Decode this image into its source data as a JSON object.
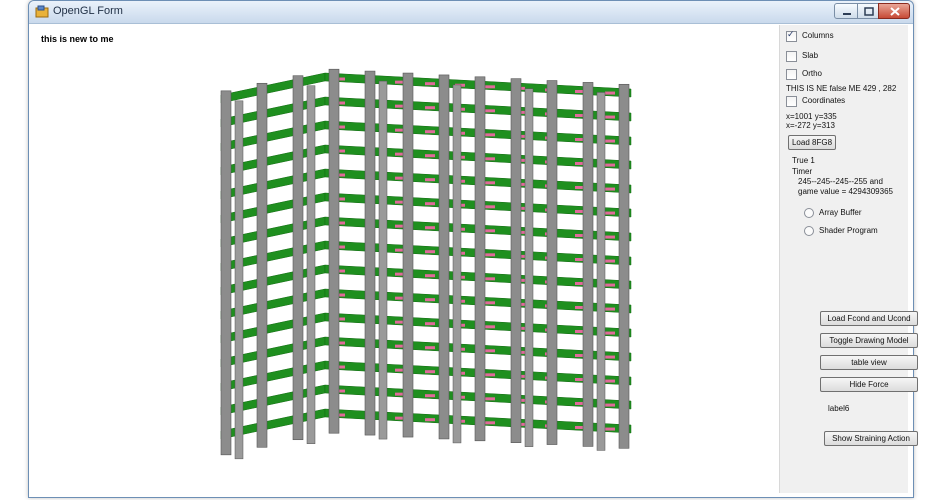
{
  "window": {
    "title": "OpenGL Form",
    "icon": "app-icon"
  },
  "gl_view": {
    "label": "this is new to me"
  },
  "panel": {
    "checkboxes": [
      {
        "label": "Columns",
        "checked": true
      },
      {
        "label": "Slab",
        "checked": false
      },
      {
        "label": "Ortho",
        "checked": false
      }
    ],
    "status_text": "THIS IS NE false  ME  429 , 282",
    "coordinates_checkbox": {
      "label": "Coordinates",
      "checked": false
    },
    "coord_line1": "x=1001 y=335",
    "coord_line2": " x=-272 y=313",
    "load_button": "Load 8FG8",
    "true_text": "True 1",
    "timer_text": "Timer",
    "color_text": "245--245--245--255 and",
    "game_value_text": "game value =  4294309365",
    "radios": [
      {
        "label": "Array Buffer"
      },
      {
        "label": "Shader Program"
      }
    ],
    "buttons": [
      "Load Fcond and Ucond",
      "Toggle Drawing Model",
      "table view",
      "Hide Force"
    ],
    "label6": "label6",
    "show_button": "Show Straining Action"
  },
  "colors": {
    "slab": "#1f8f1f",
    "column": "#8c8c8c",
    "accent": "#e06a9a"
  }
}
